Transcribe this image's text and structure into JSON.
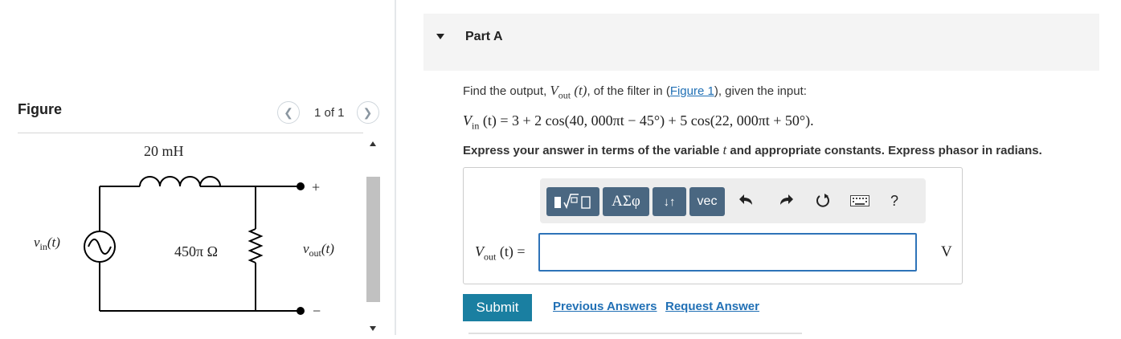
{
  "figure_pane": {
    "title": "Figure",
    "pager": {
      "prev_icon": "chevron-left-icon",
      "label": "1 of 1",
      "next_icon": "chevron-right-icon"
    },
    "circuit": {
      "inductor_label": "20 mH",
      "resistor_label": "450π Ω",
      "source_label_main": "v",
      "source_label_sub": "in",
      "source_label_suffix": "(t)",
      "output_label_main": "v",
      "output_label_sub": "out",
      "output_label_suffix": "(t)",
      "plus": "+",
      "minus": "−"
    }
  },
  "part": {
    "caret_icon": "caret-down-icon",
    "title": "Part A"
  },
  "question": {
    "prompt_before": "Find the output, ",
    "prompt_var_main": "V",
    "prompt_var_sub": "out",
    "prompt_var_suffix": " (t)",
    "prompt_middle": ", of the filter in (",
    "prompt_link": "Figure 1",
    "prompt_after": "), given the input:",
    "input_eq_main": "V",
    "input_eq_sub": "in",
    "input_eq_rest": " (t) = 3 + 2 cos(40, 000πt − 45°) + 5 cos(22, 000πt + 50°).",
    "instructions_before": "Express your answer in terms of the variable ",
    "instructions_var": "t",
    "instructions_after": " and appropriate constants. Express phasor in radians."
  },
  "toolbar": {
    "template_icon": "templates-icon",
    "greek_label": "ΑΣφ",
    "arrows_label": "↓↑",
    "vec_label": "vec",
    "undo_icon": "undo-icon",
    "redo_icon": "redo-icon",
    "reset_icon": "reset-icon",
    "keyboard_icon": "keyboard-icon",
    "help_label": "?"
  },
  "answer": {
    "label_main": "V",
    "label_sub": "out",
    "label_rest": " (t) =",
    "value": "",
    "unit": "V"
  },
  "actions": {
    "submit_label": "Submit",
    "previous_answers_label": "Previous Answers",
    "request_answer_label": "Request Answer"
  },
  "colors": {
    "button_dark": "#4a6781",
    "submit": "#1a7fa1",
    "link": "#2170b5",
    "input_border": "#2e73b8"
  }
}
